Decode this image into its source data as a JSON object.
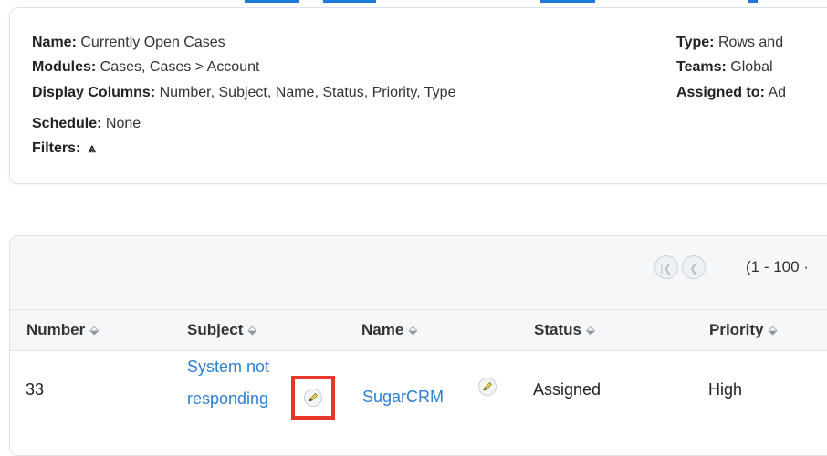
{
  "report_details": {
    "name_label": "Name:",
    "name_value": "Currently Open Cases",
    "modules_label": "Modules:",
    "modules_value": "Cases, Cases > Account",
    "display_columns_label": "Display Columns:",
    "display_columns_value": "Number, Subject, Name, Status, Priority, Type",
    "schedule_label": "Schedule:",
    "schedule_value": "None",
    "filters_label": "Filters:",
    "filters_icon": "double-chevron-up-icon",
    "type_label": "Type:",
    "type_value": "Rows and",
    "teams_label": "Teams:",
    "teams_value": "Global",
    "assigned_label": "Assigned to:",
    "assigned_value": "Ad"
  },
  "pager": {
    "range_text": "(1 - 100 ·"
  },
  "table": {
    "columns": [
      "Number",
      "Subject",
      "Name",
      "Status",
      "Priority"
    ],
    "rows": [
      {
        "number": "33",
        "subject_line1": "System not",
        "subject_line2": "responding",
        "name": "SugarCRM",
        "status": "Assigned",
        "priority": "High"
      }
    ]
  },
  "colors": {
    "link": "#2c7fd1",
    "highlight": "#e8372a",
    "top_bar": "#1d7ad8"
  }
}
